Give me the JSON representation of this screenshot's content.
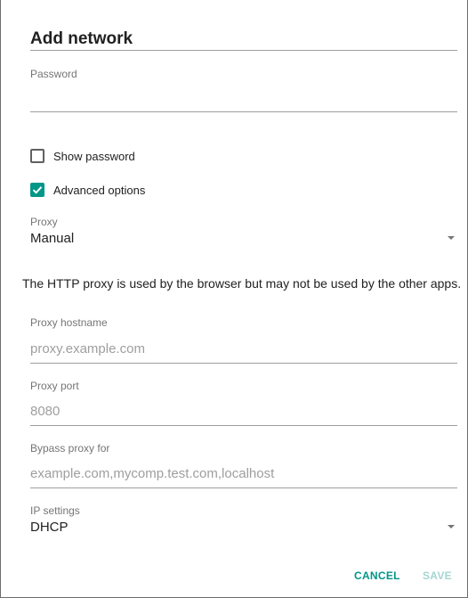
{
  "dialog": {
    "title": "Add network",
    "password": {
      "label": "Password",
      "value": ""
    },
    "show_password": {
      "label": "Show password",
      "checked": false
    },
    "advanced_options": {
      "label": "Advanced options",
      "checked": true
    },
    "proxy": {
      "label": "Proxy",
      "value": "Manual"
    },
    "proxy_note": "The HTTP proxy is used by the browser but may not be used by the other apps.",
    "proxy_hostname": {
      "label": "Proxy hostname",
      "placeholder": "proxy.example.com"
    },
    "proxy_port": {
      "label": "Proxy port",
      "placeholder": "8080"
    },
    "bypass_proxy": {
      "label": "Bypass proxy for",
      "placeholder": "example.com,mycomp.test.com,localhost"
    },
    "ip_settings": {
      "label": "IP settings",
      "value": "DHCP"
    },
    "buttons": {
      "cancel": "CANCEL",
      "save": "SAVE"
    }
  },
  "colors": {
    "accent": "#009688",
    "disabled_accent": "#a5d6d1"
  },
  "icons": [
    "checkbox-empty-icon",
    "checkbox-checked-icon",
    "dropdown-arrow-icon"
  ]
}
